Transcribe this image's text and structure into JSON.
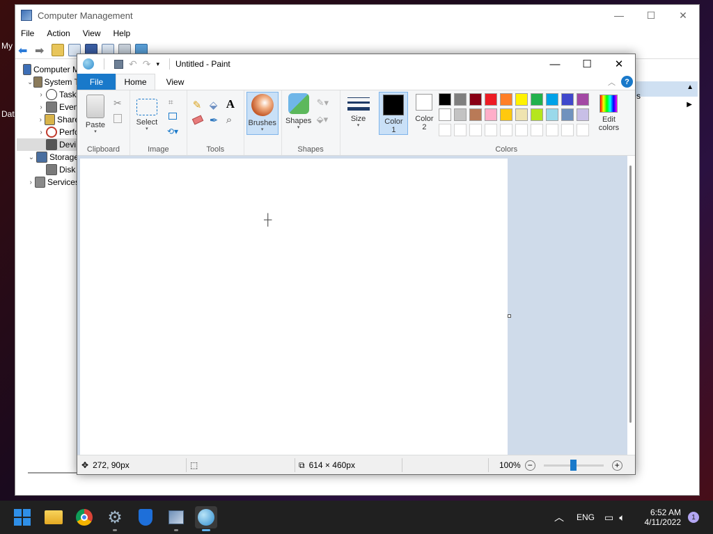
{
  "desktop": {
    "label1": "My",
    "label2": "Dat"
  },
  "computer_management": {
    "title": "Computer Management",
    "menu": [
      "File",
      "Action",
      "View",
      "Help"
    ],
    "tree": [
      {
        "label": "Computer M",
        "indent": 0,
        "arrow": "",
        "icon": "computer-icon"
      },
      {
        "label": "System T",
        "indent": 1,
        "arrow": "⌄",
        "icon": "tools-icon"
      },
      {
        "label": "Task",
        "indent": 2,
        "arrow": "›",
        "icon": "clock-icon"
      },
      {
        "label": "Even",
        "indent": 2,
        "arrow": "›",
        "icon": "event-viewer-icon"
      },
      {
        "label": "Share",
        "indent": 2,
        "arrow": "›",
        "icon": "shared-folder-icon"
      },
      {
        "label": "Perfo",
        "indent": 2,
        "arrow": "›",
        "icon": "performance-icon"
      },
      {
        "label": "Devi",
        "indent": 2,
        "arrow": "",
        "icon": "device-manager-icon"
      },
      {
        "label": "Storage",
        "indent": 1,
        "arrow": "⌄",
        "icon": "storage-icon"
      },
      {
        "label": "Disk",
        "indent": 2,
        "arrow": "",
        "icon": "disk-icon"
      },
      {
        "label": "Services",
        "indent": 1,
        "arrow": "›",
        "icon": "services-icon"
      }
    ],
    "right_pane_text": "s"
  },
  "paint": {
    "title": "Untitled - Paint",
    "tabs": {
      "file": "File",
      "home": "Home",
      "view": "View"
    },
    "groups": {
      "clipboard": "Clipboard",
      "image": "Image",
      "tools": "Tools",
      "shapes": "Shapes",
      "colors": "Colors"
    },
    "buttons": {
      "paste": "Paste",
      "select": "Select",
      "brushes": "Brushes",
      "shapes": "Shapes",
      "size": "Size",
      "color1": "Color 1",
      "color2": "Color 2",
      "edit_colors": "Edit colors"
    },
    "palette_row1": [
      "#000000",
      "#7f7f7f",
      "#880015",
      "#ed1c24",
      "#ff7f27",
      "#fff200",
      "#22b14c",
      "#00a2e8",
      "#3f48cc",
      "#a349a4"
    ],
    "palette_row2": [
      "#ffffff",
      "#c3c3c3",
      "#b97a57",
      "#ffaec9",
      "#ffc90e",
      "#efe4b0",
      "#b5e61d",
      "#99d9ea",
      "#7092be",
      "#c8bfe7"
    ],
    "palette_row3": [
      "#ffffff",
      "#ffffff",
      "#ffffff",
      "#ffffff",
      "#ffffff",
      "#ffffff",
      "#ffffff",
      "#ffffff",
      "#ffffff",
      "#ffffff"
    ],
    "color1_value": "#000000",
    "color2_value": "#ffffff",
    "status": {
      "cursor_pos": "272, 90px",
      "image_size": "614 × 460px",
      "zoom": "100%"
    }
  },
  "taskbar": {
    "lang": "ENG",
    "time": "6:52 AM",
    "date": "4/11/2022",
    "notification_count": "1"
  },
  "colors": {
    "accent": "#1979ca",
    "canvas_bg": "#cfdbea",
    "taskbar_bg": "#202020"
  }
}
